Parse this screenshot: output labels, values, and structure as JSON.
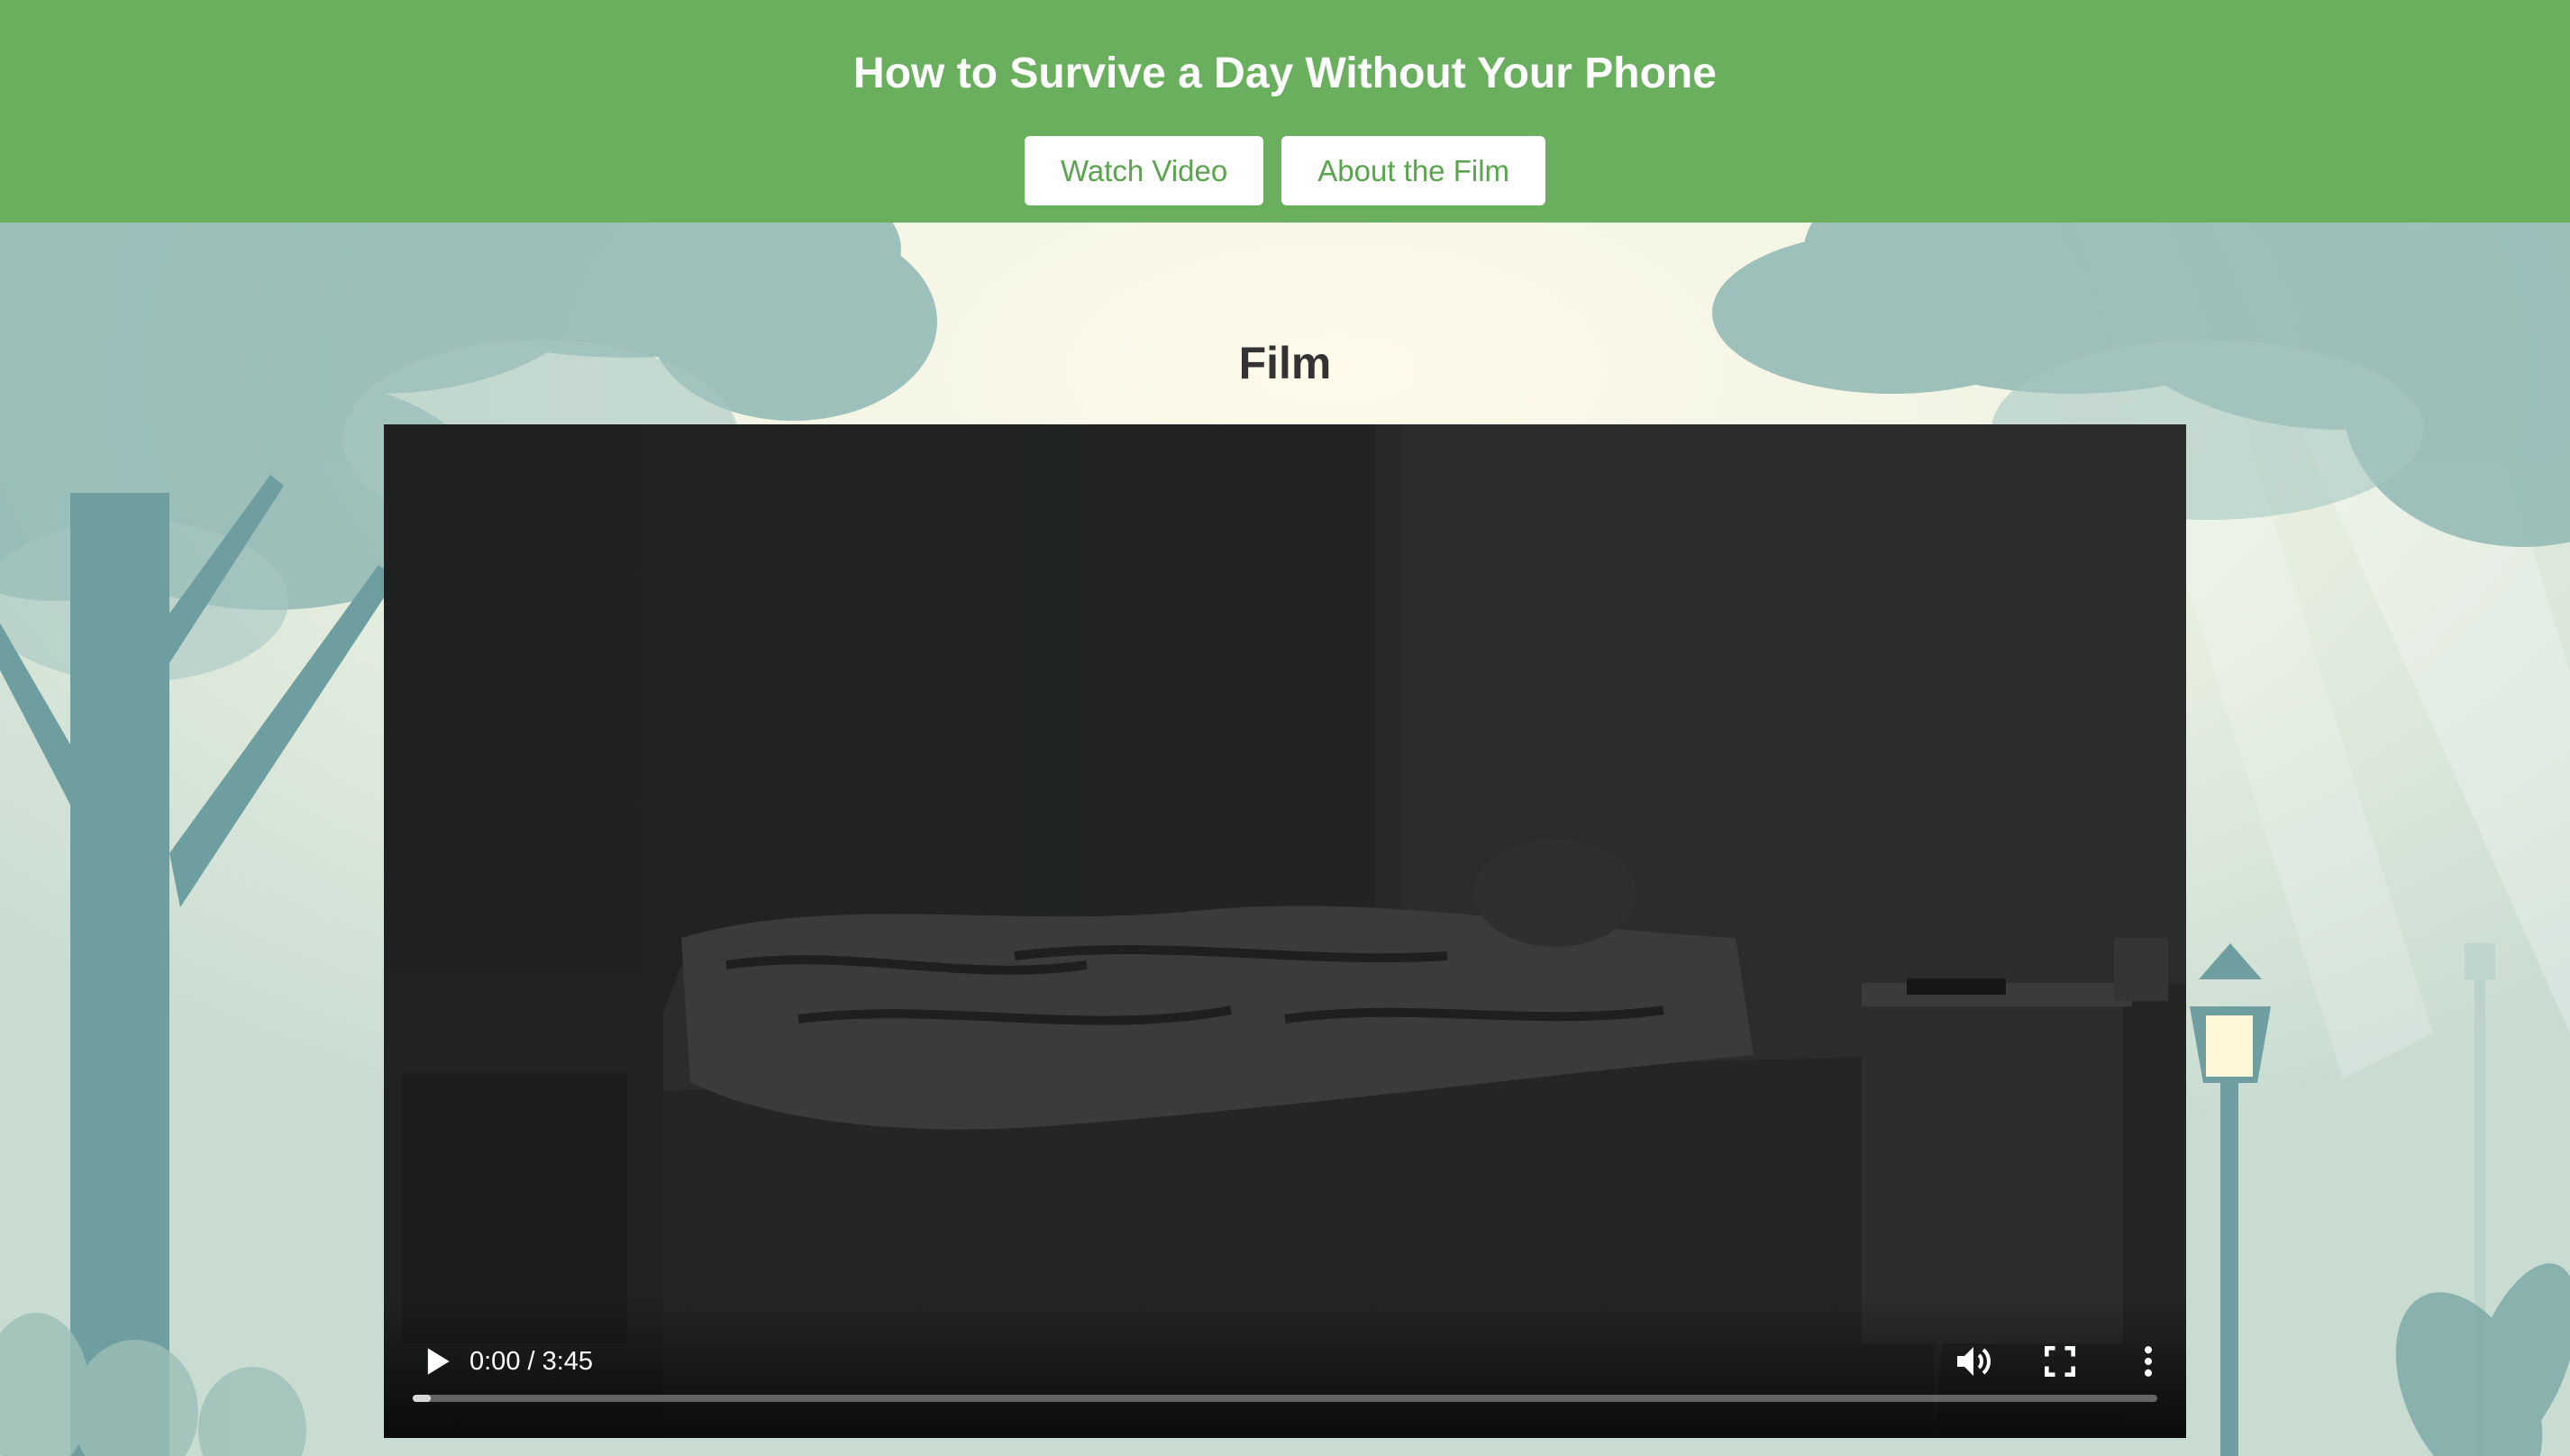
{
  "header": {
    "title": "How to Survive a Day Without Your Phone",
    "nav": [
      {
        "label": "Watch Video"
      },
      {
        "label": "About the Film"
      }
    ]
  },
  "main": {
    "section_heading": "Film"
  },
  "video": {
    "time": "0:00 / 3:45",
    "progress_fraction": 0.0,
    "icons": {
      "play": "play-icon",
      "volume": "volume-icon",
      "fullscreen": "fullscreen-icon",
      "more": "more-options-icon"
    }
  },
  "colors": {
    "header_bg": "#6aaf5e",
    "button_text": "#5aa44f",
    "heading_text": "#333333"
  }
}
